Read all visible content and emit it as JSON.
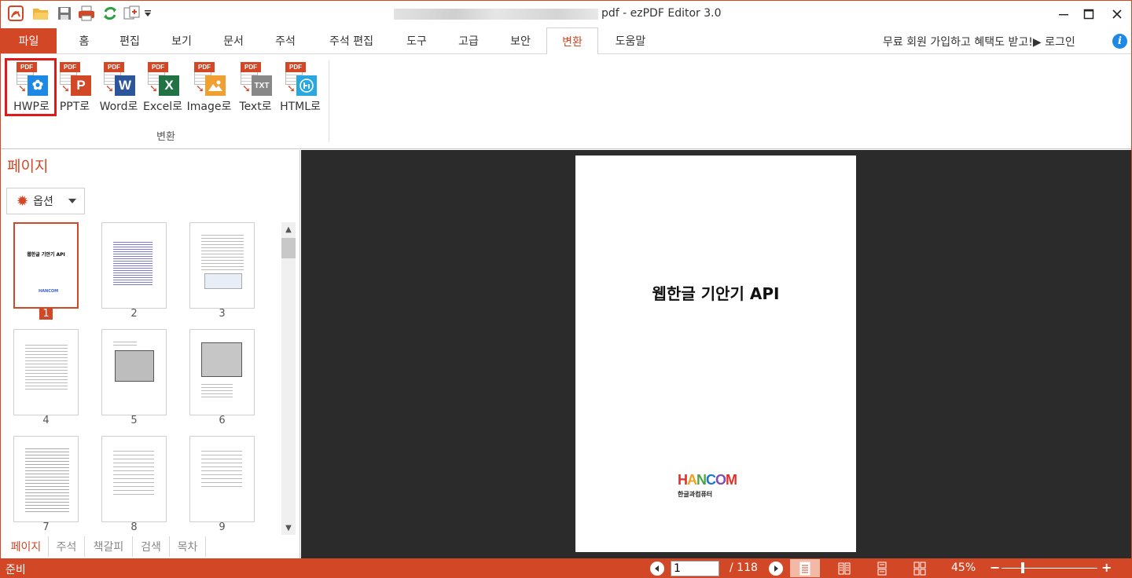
{
  "titlebar": {
    "title": "pdf -  ezPDF Editor 3.0"
  },
  "menu": {
    "file": "파일",
    "tabs": [
      "홈",
      "편집",
      "보기",
      "문서",
      "주석",
      "주석 편집",
      "도구",
      "고급",
      "보안",
      "변환",
      "도움말"
    ],
    "active_tab": "변환",
    "promo": "무료 회원 가입하고 혜택도 받고!▶ 로그인"
  },
  "ribbon": {
    "buttons": [
      {
        "label": "HWP로",
        "color": "#1e88e5",
        "icon": "hwp-convert-icon"
      },
      {
        "label": "PPT로",
        "color": "#d24726",
        "icon": "ppt-convert-icon"
      },
      {
        "label": "Word로",
        "color": "#2b579a",
        "icon": "word-convert-icon"
      },
      {
        "label": "Excel로",
        "color": "#217346",
        "icon": "excel-convert-icon"
      },
      {
        "label": "Image로",
        "color": "#f0a030",
        "icon": "image-convert-icon"
      },
      {
        "label": "Text로",
        "color": "#888888",
        "icon": "text-convert-icon"
      },
      {
        "label": "HTML로",
        "color": "#29a8e0",
        "icon": "html-convert-icon"
      }
    ],
    "group_label": "변환"
  },
  "left_panel": {
    "title": "페이지",
    "options_label": "옵션",
    "pages": [
      "1",
      "2",
      "3",
      "4",
      "5",
      "6",
      "7",
      "8",
      "9"
    ],
    "selected_page": "1",
    "tabs": [
      "페이지",
      "주석",
      "책갈피",
      "검색",
      "목차"
    ]
  },
  "document": {
    "title": "웹한글 기안기 API",
    "logo": "HANCOM",
    "logo_sub": "한글과컴퓨터"
  },
  "status": {
    "text": "준비",
    "current_page": "1",
    "total_pages": "/ 118",
    "zoom": "45%"
  },
  "colors": {
    "accent": "#d24726",
    "viewer_bg": "#2b2b2b"
  }
}
